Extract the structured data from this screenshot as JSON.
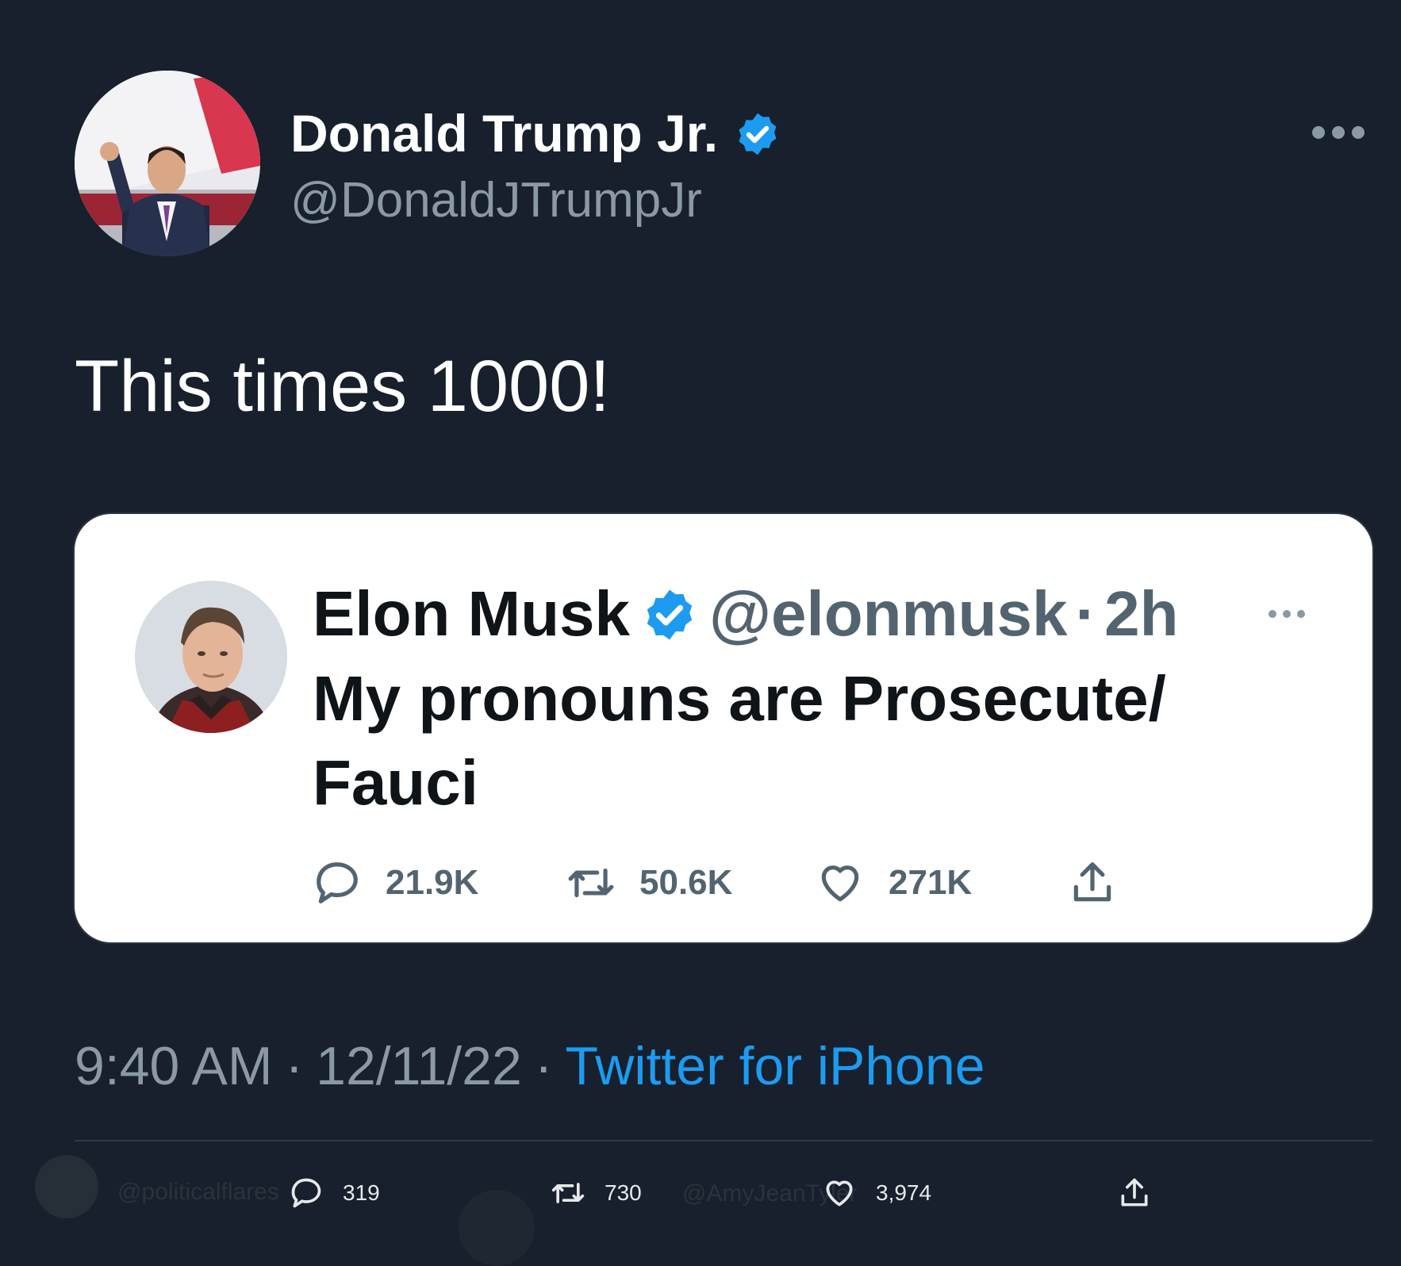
{
  "tweet": {
    "author_name": "Donald Trump Jr.",
    "author_handle": "@DonaldJTrumpJr",
    "text": "This times 1000!",
    "time": "9:40 AM",
    "date": "12/11/22",
    "separator": "·",
    "source": "Twitter for iPhone"
  },
  "quoted_tweet": {
    "author_name": "Elon Musk",
    "author_handle": "@elonmusk",
    "separator": "·",
    "time_ago": "2h",
    "text": "My pronouns are Prosecute/ Fauci",
    "replies": "21.9K",
    "retweets": "50.6K",
    "likes": "271K"
  },
  "stats": {
    "replies": "319",
    "retweets": "730",
    "likes": "3,974"
  },
  "background_ghost_text": {
    "left_handle": "@politicalflares",
    "right_text": "@AmyJeanTyler"
  },
  "colors": {
    "background": "#17202c",
    "link": "#1d9bf0",
    "verified": "#1d9bf0"
  }
}
